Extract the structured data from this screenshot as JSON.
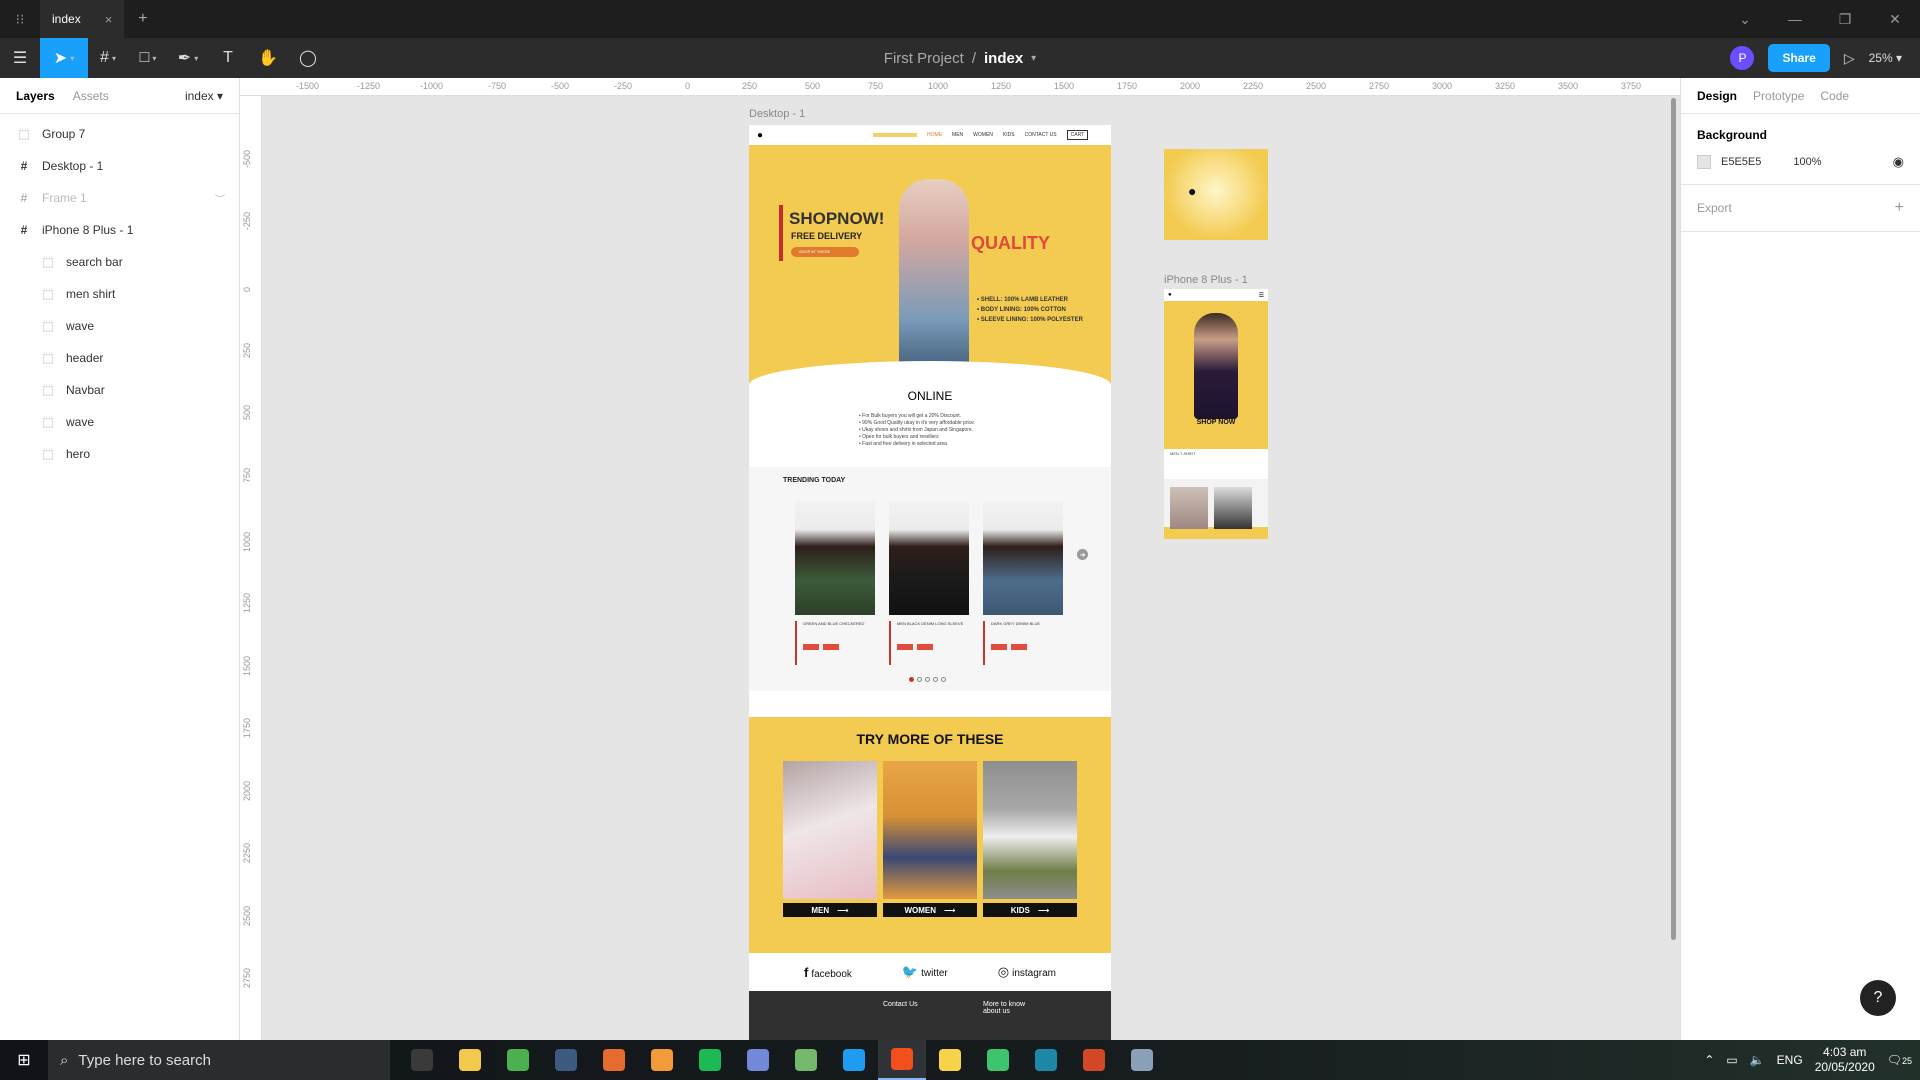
{
  "titlebar": {
    "tab_label": "index",
    "tab_close": "×",
    "new_tab": "+",
    "minimize": "—",
    "restore": "❐",
    "close": "✕",
    "chevron": "⌄"
  },
  "toolbar": {
    "project": "First Project",
    "separator": "/",
    "file": "index",
    "avatar_letter": "P",
    "share_label": "Share",
    "zoom": "25%"
  },
  "left_panel": {
    "tab_layers": "Layers",
    "tab_assets": "Assets",
    "page": "index",
    "layers": [
      {
        "name": "Group 7"
      },
      {
        "name": "Desktop - 1"
      },
      {
        "name": "Frame 1"
      },
      {
        "name": "iPhone 8 Plus - 1"
      },
      {
        "name": "search bar"
      },
      {
        "name": "men shirt"
      },
      {
        "name": "wave"
      },
      {
        "name": "header"
      },
      {
        "name": "Navbar"
      },
      {
        "name": "wave"
      },
      {
        "name": "hero"
      }
    ]
  },
  "ruler": {
    "top": [
      "-1500",
      "-1250",
      "-1000",
      "-750",
      "-500",
      "-250",
      "0",
      "250",
      "500",
      "750",
      "1000",
      "1250",
      "1500",
      "1750",
      "2000",
      "2250",
      "2500",
      "2750",
      "3000",
      "3250",
      "3500",
      "3750"
    ],
    "left": [
      "-500",
      "-250",
      "0",
      "250",
      "500",
      "750",
      "1000",
      "1250",
      "1500",
      "1750",
      "2000",
      "2250",
      "2500",
      "2750"
    ]
  },
  "canvas": {
    "desktop_label": "Desktop - 1",
    "iphone_label": "iPhone 8 Plus - 1",
    "nav": [
      "HOME",
      "MEN",
      "WOMEN",
      "KIDS",
      "CONTACT US",
      "CART"
    ],
    "hero_shop": "SHOPNOW!",
    "hero_free": "FREE DELIVERY",
    "hero_btn": "SHOP AT THESE",
    "hero_quality": "QUALITY",
    "hero_features": [
      "• SHELL: 100% LAMB LEATHER",
      "• BODY LINING: 100% COTTON",
      "• SLEEVE LINING: 100% POLYESTER"
    ],
    "online_title": "ONLINE",
    "online_points": [
      "• For Bulk buyers you will get a 20% Discount.",
      "• 99% Good Quality ukay in it's very affordable price.",
      "• Ukay shoes and shirts from Japan and Singapore.",
      "• Open for bulk buyers and resellers",
      "• Fast and free delivery in selected area"
    ],
    "trending_title": "TRENDING TODAY",
    "trending_cards": [
      {
        "name": "GREEN AND BLUE CHECKERED"
      },
      {
        "name": "MEN BLACK DENIM LONG SLEEVE"
      },
      {
        "name": "DARK GREY DENIM BLUE"
      }
    ],
    "next_arrow": "➜",
    "try_title": "TRY MORE OF THESE",
    "try_cards": [
      {
        "label": "MEN",
        "color": "#d9b9bb"
      },
      {
        "label": "WOMEN",
        "color": "#e59a3c"
      },
      {
        "label": "KIDS",
        "color": "#9a9a9a"
      }
    ],
    "arrow": "⟶",
    "social": [
      {
        "icon": "f",
        "label": "facebook"
      },
      {
        "icon": "🐦",
        "label": "twitter"
      },
      {
        "icon": "◎",
        "label": "instagram"
      }
    ],
    "footer_contact": "Contact Us",
    "footer_more": "More to know about us",
    "iphone_shop": "SHOP NOW",
    "iphone_menshirt": "MEN T-SHIRT"
  },
  "right_panel": {
    "tab_design": "Design",
    "tab_prototype": "Prototype",
    "tab_code": "Code",
    "background_title": "Background",
    "bg_hex": "E5E5E5",
    "bg_opacity": "100%",
    "export_label": "Export",
    "export_plus": "+"
  },
  "help": "?",
  "taskbar": {
    "search_placeholder": "Type here to search",
    "apps": [
      {
        "name": "task-view",
        "color": "#3a3a3a"
      },
      {
        "name": "file-explorer",
        "color": "#f2c94c"
      },
      {
        "name": "chrome",
        "color": "#4caf50"
      },
      {
        "name": "app-blue",
        "color": "#3d5a80"
      },
      {
        "name": "app-orange",
        "color": "#e56b2f"
      },
      {
        "name": "sublime",
        "color": "#f29b38"
      },
      {
        "name": "spotify",
        "color": "#1db954"
      },
      {
        "name": "discord",
        "color": "#7289da"
      },
      {
        "name": "notepad",
        "color": "#74b86b"
      },
      {
        "name": "vscode",
        "color": "#1f9cf0"
      },
      {
        "name": "figma",
        "color": "#f24e1e"
      },
      {
        "name": "sticky-notes",
        "color": "#f7d34a"
      },
      {
        "name": "app-green",
        "color": "#3ec46d"
      },
      {
        "name": "app-teal",
        "color": "#1e88a8"
      },
      {
        "name": "powerpoint",
        "color": "#d24726"
      },
      {
        "name": "app-palette",
        "color": "#8aa0b8"
      }
    ],
    "lang": "ENG",
    "time": "4:03 am",
    "date": "20/05/2020",
    "notif_count": "25"
  }
}
